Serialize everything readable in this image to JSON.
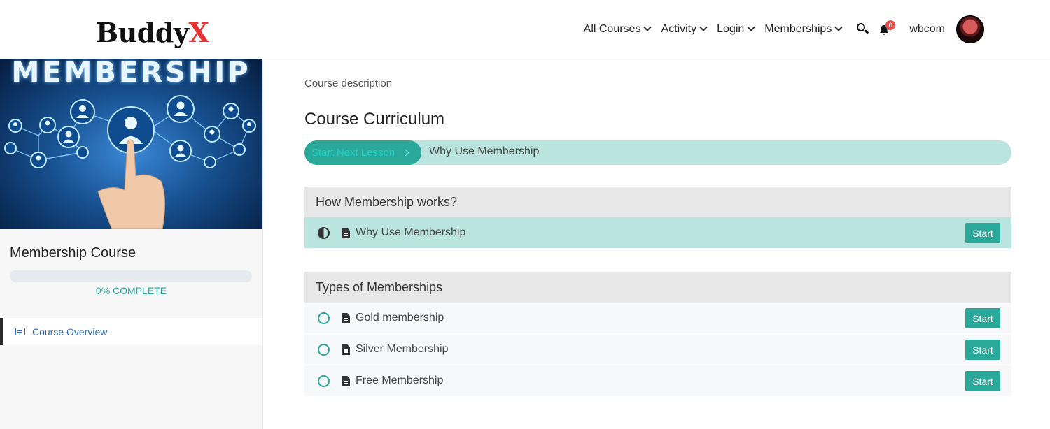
{
  "header": {
    "logo_main": "Buddy",
    "logo_accent": "X",
    "nav": [
      {
        "label": "All Courses"
      },
      {
        "label": "Activity"
      },
      {
        "label": "Login"
      },
      {
        "label": "Memberships"
      }
    ],
    "notification_count": "0",
    "username": "wbcom"
  },
  "sidebar": {
    "hero_text": "MEMBERSHIP",
    "course_title": "Membership Course",
    "progress_percent": 0,
    "progress_pct_text": "0%",
    "progress_word": "COMPLETE",
    "overview_label": "Course Overview"
  },
  "main": {
    "description": "Course description",
    "curriculum_title": "Course Curriculum",
    "next_button_label": "Start Next Lesson",
    "next_lesson_title": "Why Use Membership",
    "sections": [
      {
        "title": "How Membership works?",
        "lessons": [
          {
            "title": "Why Use Membership",
            "status": "in-progress",
            "action": "Start"
          }
        ]
      },
      {
        "title": "Types of Memberships",
        "lessons": [
          {
            "title": "Gold membership",
            "status": "not-started",
            "action": "Start"
          },
          {
            "title": "Silver Membership",
            "status": "not-started",
            "action": "Start"
          },
          {
            "title": "Free Membership",
            "status": "not-started",
            "action": "Start"
          }
        ]
      }
    ]
  },
  "colors": {
    "accent": "#2aa89a",
    "accent_light": "#b9e4df",
    "logo_x": "#e83434",
    "badge": "#e65050"
  }
}
